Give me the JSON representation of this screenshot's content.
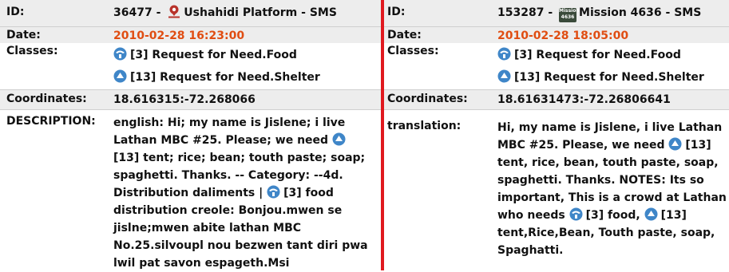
{
  "left": {
    "id_label": "ID:",
    "id_number": "36477",
    "id_sep": " - ",
    "source": "Ushahidi Platform - SMS",
    "logo_text": "Ushahidi",
    "date_label": "Date:",
    "date": "2010-02-28 16:23:00",
    "classes_label": "Classes:",
    "classes": [
      "[3] Request for Need.Food",
      "[13] Request for Need.Shelter"
    ],
    "coord_label": "Coordinates:",
    "coords": "18.616315:-72.268066",
    "desc_label": "DESCRIPTION:",
    "desc_lines": [
      "english: Hi; my name is Jislene; i live",
      "Lathan MBC #25. Please; we need",
      "[13] tent; rice; bean; touth paste; soap;",
      "spaghetti. Thanks. -- Category: --4d.",
      "Distribution daliments |",
      "distribution creole: Bonjou.mwen se",
      "jislne;mwen abite lathan MBC",
      "No.25.silvoupl nou bezwen tant diri pwa",
      "lwil pat savon espageth.Msi"
    ],
    "desc_inline_food": "[3] food"
  },
  "right": {
    "id_label": "ID:",
    "id_number": "153287",
    "id_sep": " - ",
    "source": "Mission 4636 - SMS",
    "logo_text_top": "Mission",
    "logo_text_bottom": "4636",
    "date_label": "Date:",
    "date": "2010-02-28 18:05:00",
    "classes_label": "Classes:",
    "classes": [
      "[3] Request for Need.Food",
      "[13] Request for Need.Shelter"
    ],
    "coord_label": "Coordinates:",
    "coords": "18.61631473:-72.26806641",
    "trans_label": "translation:",
    "trans_lines": [
      "Hi, my name is Jislene, i live Lathan",
      "MBC #25. Please, we need",
      "tent, rice, bean, touth paste, soap,",
      "spaghetti. Thanks. NOTES: Its so",
      "important, This is a crowd at Lathan",
      "who needs",
      "tent,Rice,Bean, Touth paste, soap,",
      "Spaghatti."
    ],
    "trans_inline_13": "[13]",
    "trans_inline_food": "[3] food,",
    "trans_inline_13b": "[13]"
  },
  "colors": {
    "divider": "#e0191f",
    "date": "#e04d12",
    "row_shade": "#ededed",
    "icon_blue": "#3f86c8"
  },
  "icons": {
    "category": "category-globe-icon",
    "ushahidi": "ushahidi-logo-icon",
    "mission": "mission-4636-logo-icon"
  }
}
